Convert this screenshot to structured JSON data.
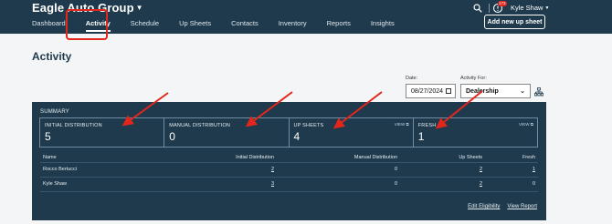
{
  "header": {
    "brand": "Eagle Auto Group",
    "nav": [
      "Dashboard",
      "Activity",
      "Schedule",
      "Up Sheets",
      "Contacts",
      "Inventory",
      "Reports",
      "Insights"
    ],
    "notif_count": "173",
    "user_name": "Kyle Shaw",
    "add_button": "Add new up sheet"
  },
  "page": {
    "title": "Activity"
  },
  "filters": {
    "date_label": "Date:",
    "date_value": "08/27/2024",
    "for_label": "Activity For:",
    "for_value": "Dealership"
  },
  "summary": {
    "label": "SUMMARY",
    "cards": [
      {
        "title": "INITIAL DISTRIBUTION",
        "value": "5",
        "view": ""
      },
      {
        "title": "MANUAL DISTRIBUTION",
        "value": "0",
        "view": ""
      },
      {
        "title": "UP SHEETS",
        "value": "4",
        "view": "VIEW"
      },
      {
        "title": "FRESH",
        "value": "1",
        "view": "VIEW"
      }
    ]
  },
  "table": {
    "headers": [
      "Name",
      "Initial Distribution",
      "Manual Distribution",
      "Up Sheets",
      "Fresh"
    ],
    "rows": [
      [
        "Rocco Bertucci",
        "2",
        "0",
        "2",
        "1"
      ],
      [
        "Kyle Shaw",
        "3",
        "0",
        "2",
        "0"
      ]
    ]
  },
  "footer": {
    "edit": "Edit Eligibility",
    "report": "View Report"
  },
  "colors": {
    "navy": "#1e3a4c",
    "highlight_red": "#e2261c"
  }
}
